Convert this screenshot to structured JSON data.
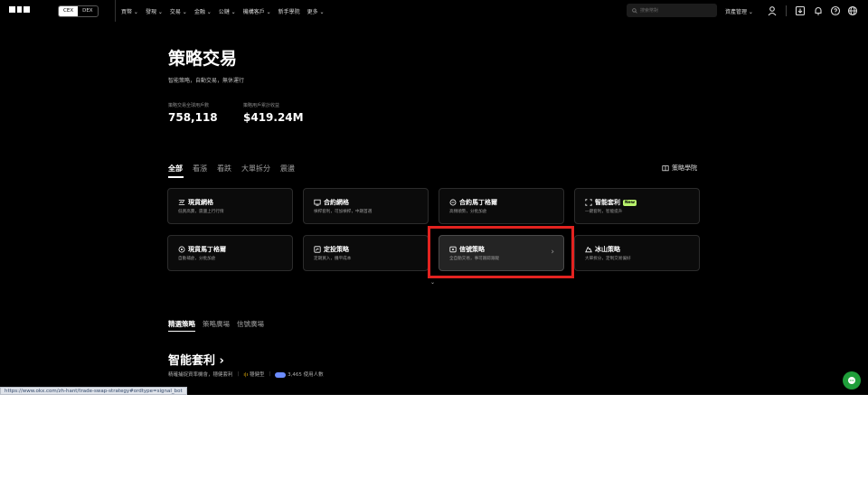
{
  "header": {
    "segments": [
      "CEX",
      "DEX"
    ],
    "nav": [
      "買幣 ⌄",
      "發現 ⌄",
      "交易 ⌄",
      "金融 ⌄",
      "公鏈 ⌄",
      "機構客戶 ⌄",
      "新手學院",
      "更多 ⌄"
    ],
    "search_placeholder": "搜索幣對",
    "assets_label": "資產管理 ⌄",
    "icons": [
      "user-icon",
      "download-icon",
      "bell-icon",
      "help-icon",
      "globe-icon"
    ]
  },
  "hero": {
    "title": "策略交易",
    "subtitle": "智能策略，自動交易，無休運行",
    "stats": [
      {
        "label": "策略交易全球用戶數",
        "value": "758,118"
      },
      {
        "label": "策略用戶累計收益",
        "value": "$419.24M"
      }
    ]
  },
  "tabs": [
    "全部",
    "看漲",
    "看跌",
    "大單拆分",
    "震盪"
  ],
  "academy_label": "策略學院",
  "cards": [
    {
      "title": "現貨網格",
      "desc": "低買高賣，震盪上行行情",
      "icon": "grid-icon"
    },
    {
      "title": "合約網格",
      "desc": "槓桿套利，可加槓桿，中期首選",
      "icon": "contract-grid-icon"
    },
    {
      "title": "合約馬丁格爾",
      "desc": "高頻順勢，分批加倉",
      "icon": "martingale-icon"
    },
    {
      "title": "智能套利",
      "desc": "一鍵套利，智能提升",
      "icon": "arbitrage-icon",
      "badge": "New"
    },
    {
      "title": "現貨馬丁格爾",
      "desc": "自動補倉，分批加倉",
      "icon": "target-icon"
    },
    {
      "title": "定投策略",
      "desc": "定期買入，攤平成本",
      "icon": "dca-icon"
    },
    {
      "title": "信號策略",
      "desc": "全自動交易，事可跟踪跟蹤",
      "icon": "signal-icon"
    },
    {
      "title": "冰山策略",
      "desc": "大單拆分，定制交易偏好",
      "icon": "iceberg-icon"
    }
  ],
  "subtabs": [
    "精選策略",
    "策略廣場",
    "信號廣場"
  ],
  "section": {
    "title": "智能套利",
    "desc": "精確捕捉資率機會，穩健套利",
    "risk_label": "穩健型",
    "users": "3,465 使用人數"
  },
  "status_url": "https://www.okx.com/zh-hant/trade-swap-strategy#ordtype=signal_bot",
  "colors": {
    "highlight": "#e32320",
    "badge": "#b8f26c",
    "chat": "#1f9e3a"
  }
}
